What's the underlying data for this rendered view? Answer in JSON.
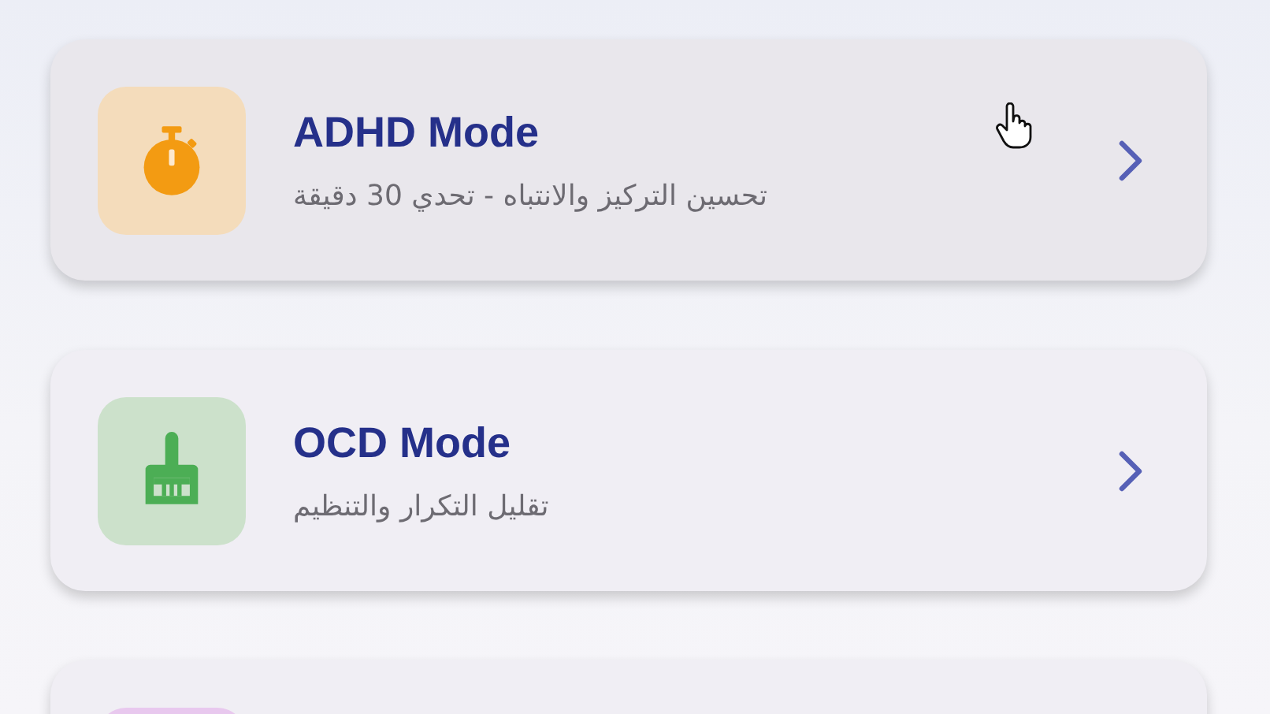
{
  "modes": [
    {
      "kind": "stopwatch",
      "color": "#f39b12",
      "title": "ADHD Mode",
      "subtitle": "تحسين التركيز والانتباه - تحدي 30 دقيقة",
      "hovered": true
    },
    {
      "kind": "broom",
      "color": "#4cae55",
      "title": "OCD Mode",
      "subtitle": "تقليل التكرار والتنظيم",
      "hovered": false
    },
    {
      "kind": "partial"
    }
  ]
}
